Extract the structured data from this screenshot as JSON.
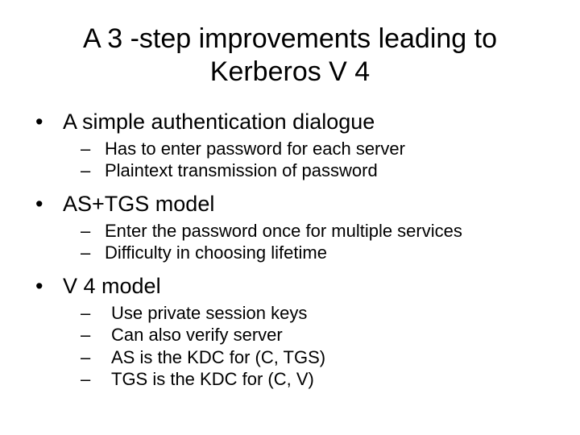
{
  "title": "A 3 -step improvements leading to Kerberos V 4",
  "bullets": [
    {
      "text": "A simple authentication dialogue",
      "sub": [
        "Has to enter password for each server",
        "Plaintext transmission of password"
      ]
    },
    {
      "text": "AS+TGS model",
      "sub": [
        "Enter the password once for multiple services",
        "Difficulty in choosing lifetime"
      ]
    },
    {
      "text": "V 4 model",
      "sub": [
        "Use private session keys",
        "Can also verify server",
        "AS is the KDC for (C, TGS)",
        "TGS is the KDC for (C, V)"
      ],
      "wideDash": true
    }
  ]
}
